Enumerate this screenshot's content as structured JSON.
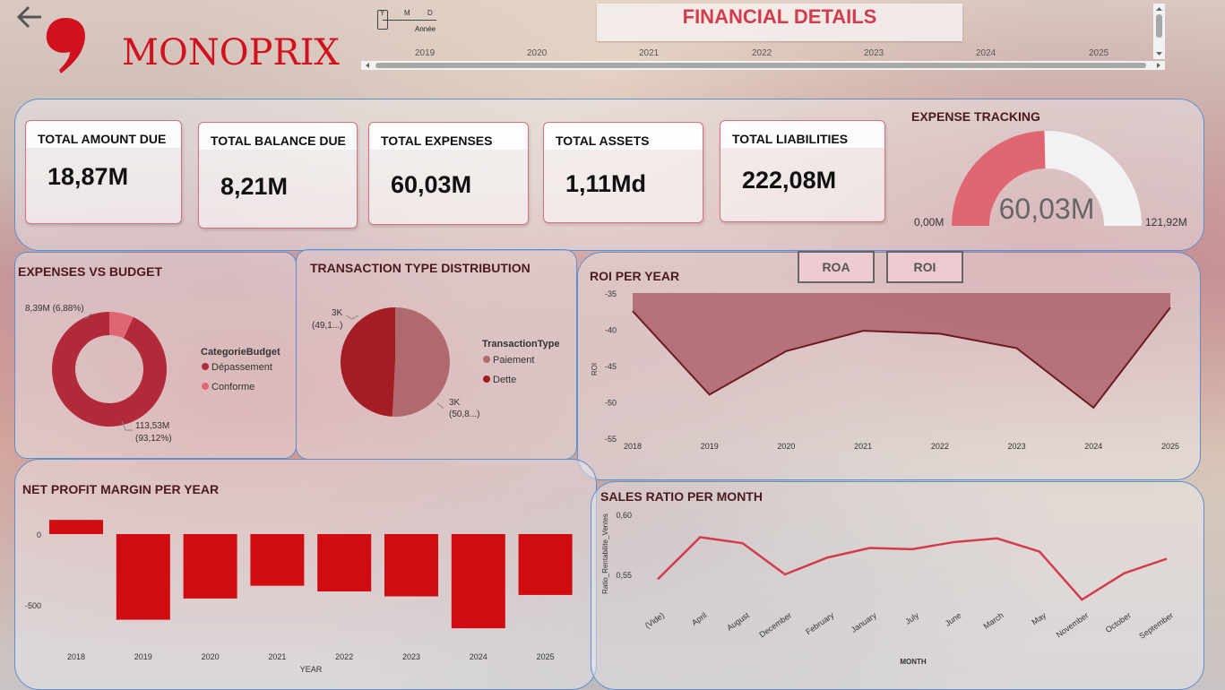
{
  "brand": {
    "name": "MONOPRIX",
    "color": "#d1121e"
  },
  "timeline": {
    "title": "FINANCIAL DETAILS",
    "granularity": [
      "Y",
      "M",
      "D"
    ],
    "granularity_label": "Année",
    "years": [
      "2019",
      "2020",
      "2021",
      "2022",
      "2023",
      "2024",
      "2025"
    ]
  },
  "kpis": [
    {
      "title": "TOTAL AMOUNT DUE",
      "value": "18,87M"
    },
    {
      "title": "TOTAL BALANCE DUE",
      "value": "8,21M"
    },
    {
      "title": "TOTAL EXPENSES",
      "value": "60,03M"
    },
    {
      "title": "TOTAL ASSETS",
      "value": "1,11Md"
    },
    {
      "title": "TOTAL LIABILITIES",
      "value": "222,08M"
    }
  ],
  "gauge": {
    "title": "EXPENSE TRACKING",
    "value_label": "60,03M",
    "min_label": "0,00M",
    "max_label": "121,92M",
    "value": 60.03,
    "min": 0,
    "max": 121.92,
    "fill_color": "#e06672",
    "track_color": "#f2f2f2"
  },
  "expenses_vs_budget": {
    "title": "EXPENSES VS BUDGET",
    "legend_title": "CategorieBudget",
    "legend": [
      "Dépassement",
      "Conforme"
    ],
    "colors": [
      "#b22a3a",
      "#e06672"
    ],
    "label_small": "8,39M (6,88%)",
    "label_large_1": "113,53M",
    "label_large_2": "(93,12%)",
    "chart_data": {
      "type": "pie",
      "categories": [
        "Dépassement",
        "Conforme"
      ],
      "values": [
        113.53,
        8.39
      ]
    }
  },
  "transaction_type": {
    "title": "TRANSACTION TYPE DISTRIBUTION",
    "legend_title": "TransactionType",
    "legend": [
      "Paiement",
      "Dette"
    ],
    "colors": [
      "#b06a6e",
      "#a51d24"
    ],
    "label_left_1": "3K",
    "label_left_2": "(49,1...)",
    "label_right_1": "3K",
    "label_right_2": "(50,8...)",
    "chart_data": {
      "type": "pie",
      "categories": [
        "Paiement",
        "Dette"
      ],
      "values": [
        50.8,
        49.1
      ]
    }
  },
  "roi_buttons": {
    "roa": "ROA",
    "roi": "ROI"
  },
  "roi_per_year": {
    "title": "ROI PER YEAR",
    "ylabel": "ROI",
    "yticks": [
      "-35",
      "-40",
      "-45",
      "-50",
      "-55"
    ],
    "chart_data": {
      "type": "area",
      "x": [
        "2018",
        "2019",
        "2020",
        "2021",
        "2022",
        "2023",
        "2024",
        "2025"
      ],
      "y": [
        -37.5,
        -49,
        -43,
        -40.2,
        -40.6,
        -42.6,
        -50.8,
        -37
      ],
      "ylim": [
        -55,
        -35
      ]
    }
  },
  "net_profit_margin": {
    "title": "NET PROFIT MARGIN PER YEAR",
    "xlabel": "YEAR",
    "yticks": [
      "0",
      "-500"
    ],
    "chart_data": {
      "type": "bar",
      "categories": [
        "2018",
        "2019",
        "2020",
        "2021",
        "2022",
        "2023",
        "2024",
        "2025"
      ],
      "values": [
        100,
        -605,
        -455,
        -365,
        -405,
        -440,
        -665,
        -430
      ],
      "ylim": [
        -700,
        120
      ]
    }
  },
  "sales_ratio": {
    "title": "SALES RATIO PER MONTH",
    "xlabel": "MONTH",
    "ylabel": "Ratio_Rentabilite_Ventes",
    "yticks": [
      "0,60",
      "0,55"
    ],
    "chart_data": {
      "type": "line",
      "x": [
        "(Vide)",
        "April",
        "August",
        "December",
        "February",
        "January",
        "July",
        "June",
        "March",
        "May",
        "November",
        "October",
        "September"
      ],
      "y": [
        0.546,
        0.581,
        0.576,
        0.55,
        0.564,
        0.572,
        0.571,
        0.577,
        0.58,
        0.569,
        0.529,
        0.551,
        0.563
      ],
      "ylim": [
        0.52,
        0.6
      ]
    }
  }
}
